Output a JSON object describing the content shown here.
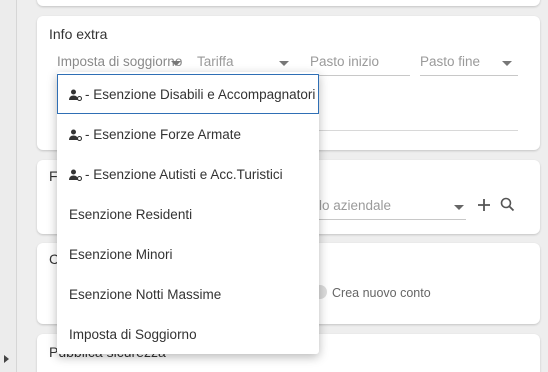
{
  "sections": {
    "info_extra": {
      "title": "Info extra",
      "fields": [
        {
          "placeholder": "Imposta di soggiorno"
        },
        {
          "placeholder": "Tariffa"
        },
        {
          "placeholder": "Pasto inizio"
        },
        {
          "placeholder": "Pasto fine"
        }
      ]
    },
    "profile": {
      "title_visible": "F",
      "profile_field_placeholder": "ilo aziendale"
    },
    "account": {
      "title_visible": "C",
      "toggle_label": "Crea nuovo conto"
    },
    "next_title": "Pubblica sicurezza"
  },
  "dropdown": {
    "options": [
      {
        "label": "- Esenzione Disabili e Accompagnatori",
        "icon": "user-group-icon",
        "selected": true
      },
      {
        "label": "- Esenzione Forze Armate",
        "icon": "user-group-icon",
        "selected": false
      },
      {
        "label": "- Esenzione Autisti e Acc.Turistici",
        "icon": "user-group-icon",
        "selected": false
      },
      {
        "label": "Esenzione Residenti",
        "icon": "",
        "selected": false
      },
      {
        "label": "Esenzione Minori",
        "icon": "",
        "selected": false
      },
      {
        "label": "Esenzione Notti Massime",
        "icon": "",
        "selected": false
      },
      {
        "label": "Imposta di Soggiorno",
        "icon": "",
        "selected": false
      }
    ]
  },
  "colors": {
    "selected_outline": "#2f6fb5",
    "background": "#eeeeee"
  }
}
